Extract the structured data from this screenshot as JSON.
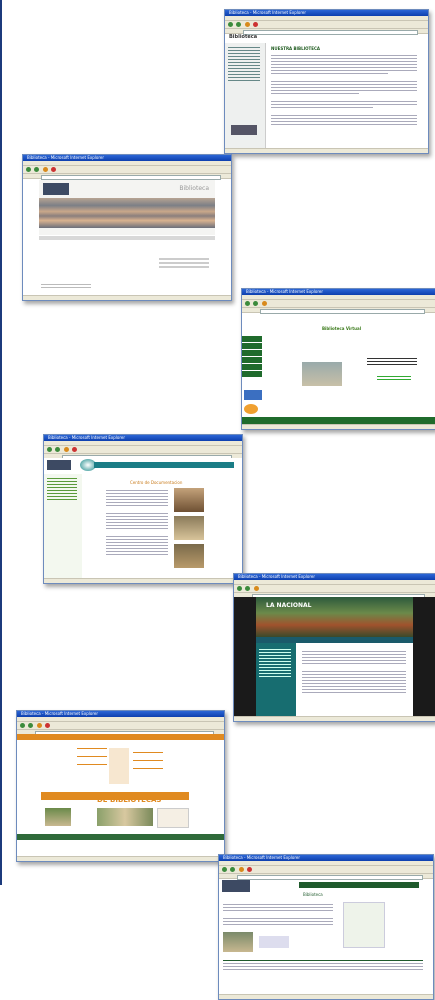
{
  "screenshots": [
    {
      "name": "shot-1",
      "title": "Biblioteca - Microsoft Internet Explorer",
      "heading": "Biblioteca",
      "section_title": "NUESTRA BIBLIOTECA"
    },
    {
      "name": "shot-2",
      "title": "Biblioteca - Microsoft Internet Explorer",
      "heading": "Biblioteca"
    },
    {
      "name": "shot-3",
      "title": "Biblioteca - Microsoft Internet Explorer",
      "heading": "Biblioteca Virtual"
    },
    {
      "name": "shot-4",
      "title": "Biblioteca - Microsoft Internet Explorer",
      "heading": "Centro de Documentacion"
    },
    {
      "name": "shot-5",
      "title": "Biblioteca - Microsoft Internet Explorer",
      "heading": "LA NACIONAL"
    },
    {
      "name": "shot-6",
      "title": "Biblioteca - Microsoft Internet Explorer",
      "heading": "DE BIBLIOTECAS"
    },
    {
      "name": "shot-7",
      "title": "Biblioteca - Microsoft Internet Explorer",
      "heading": "Biblioteca"
    }
  ]
}
